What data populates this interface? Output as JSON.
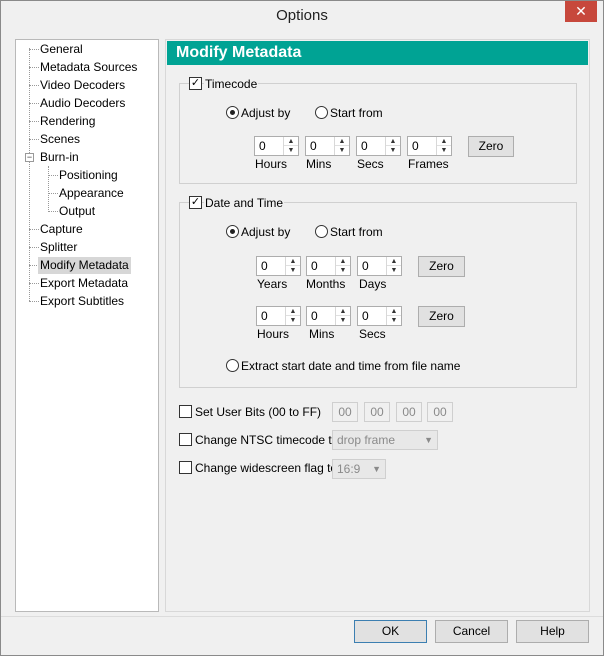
{
  "window": {
    "title": "Options",
    "close_glyph": "✕"
  },
  "tree": {
    "items": [
      {
        "label": "General"
      },
      {
        "label": "Metadata Sources"
      },
      {
        "label": "Video Decoders"
      },
      {
        "label": "Audio Decoders"
      },
      {
        "label": "Rendering"
      },
      {
        "label": "Scenes"
      },
      {
        "label": "Burn-in",
        "expander": "−"
      },
      {
        "label": "Positioning"
      },
      {
        "label": "Appearance"
      },
      {
        "label": "Output"
      },
      {
        "label": "Capture"
      },
      {
        "label": "Splitter"
      },
      {
        "label": "Modify Metadata",
        "selected": true
      },
      {
        "label": "Export Metadata"
      },
      {
        "label": "Export Subtitles"
      }
    ]
  },
  "panel": {
    "header": "Modify Metadata",
    "accent_color": "#00a394",
    "timecode": {
      "label": "Timecode",
      "checked": true,
      "adjust_label": "Adjust by",
      "start_label": "Start from",
      "fields": [
        {
          "value": "0",
          "label": "Hours"
        },
        {
          "value": "0",
          "label": "Mins"
        },
        {
          "value": "0",
          "label": "Secs"
        },
        {
          "value": "0",
          "label": "Frames"
        }
      ],
      "zero_label": "Zero"
    },
    "datetime": {
      "label": "Date and Time",
      "checked": true,
      "adjust_label": "Adjust by",
      "start_label": "Start from",
      "date_fields": [
        {
          "value": "0",
          "label": "Years"
        },
        {
          "value": "0",
          "label": "Months"
        },
        {
          "value": "0",
          "label": "Days"
        }
      ],
      "time_fields": [
        {
          "value": "0",
          "label": "Hours"
        },
        {
          "value": "0",
          "label": "Mins"
        },
        {
          "value": "0",
          "label": "Secs"
        }
      ],
      "zero_label": "Zero",
      "extract_label": "Extract start date and time from file name"
    },
    "user_bits": {
      "label": "Set User Bits (00 to FF)",
      "values": [
        "00",
        "00",
        "00",
        "00"
      ]
    },
    "ntsc": {
      "label": "Change NTSC timecode to",
      "value": "drop frame"
    },
    "widescreen": {
      "label": "Change widescreen flag to",
      "value": "16:9"
    }
  },
  "footer": {
    "ok": "OK",
    "cancel": "Cancel",
    "help": "Help"
  }
}
